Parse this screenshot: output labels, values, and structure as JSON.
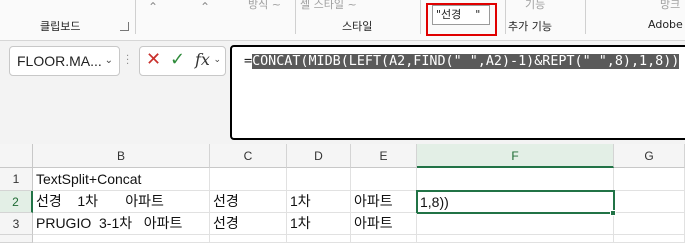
{
  "ribbon": {
    "clipboard_group": "클립보드",
    "styles_group": "스타일",
    "addins_group": "추가 기능",
    "adobe_group": "Adobe",
    "cell_style_label": "셀 스타일 ~",
    "style_box_value": "\"선경    \"",
    "addins_top": "기능",
    "dir_top": "방식 ~",
    "right_top": "망크"
  },
  "formula_bar": {
    "name_box": "FLOOR.MA...",
    "cancel_icon": "✕",
    "enter_icon": "✓",
    "fx_label": "fx",
    "formula_equals": "=",
    "formula_selected": "CONCAT(MIDB(LEFT(A2,FIND(\" \",A2)-1)&REPT(\" \",8),1,8))"
  },
  "grid": {
    "columns": [
      "B",
      "C",
      "D",
      "E",
      "F",
      "G"
    ],
    "active_column": "F",
    "rows": [
      {
        "num": "1",
        "cells": [
          "TextSplit+Concat",
          "",
          "",
          "",
          "",
          ""
        ]
      },
      {
        "num": "2",
        "cells": [
          "선경    1차       아파트",
          "선경",
          "1차",
          "아파트",
          "1,8))",
          ""
        ]
      },
      {
        "num": "3",
        "cells": [
          "PRUGIO  3-1차   아파트",
          "선경",
          "1차",
          "아파트",
          "",
          ""
        ]
      }
    ],
    "active_row": "2"
  },
  "colors": {
    "accent": "#217346",
    "highlight": "#e00000",
    "selection": "#5a5a5a"
  }
}
